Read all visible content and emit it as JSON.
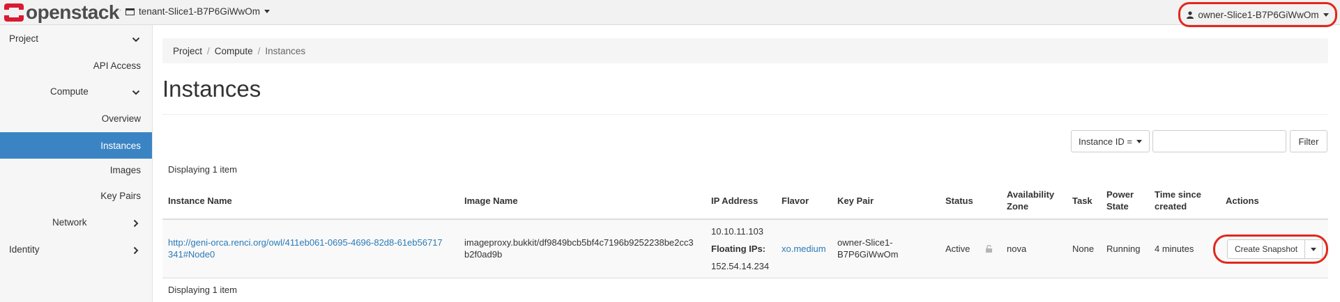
{
  "header": {
    "brand": "openstack",
    "project_selector": "tenant-Slice1-B7P6GiWwOm",
    "user_menu": "owner-Slice1-B7P6GiWwOm"
  },
  "sidebar": {
    "project": "Project",
    "api_access": "API Access",
    "compute": "Compute",
    "overview": "Overview",
    "instances": "Instances",
    "images": "Images",
    "key_pairs": "Key Pairs",
    "network": "Network",
    "identity": "Identity"
  },
  "breadcrumb": [
    "Project",
    "Compute",
    "Instances"
  ],
  "page": {
    "title": "Instances",
    "displaying_top": "Displaying 1 item",
    "displaying_bottom": "Displaying 1 item"
  },
  "filter": {
    "field": "Instance ID =",
    "value": "",
    "button": "Filter"
  },
  "table": {
    "columns": {
      "instance_name": "Instance Name",
      "image_name": "Image Name",
      "ip_address": "IP Address",
      "flavor": "Flavor",
      "key_pair": "Key Pair",
      "status": "Status",
      "availability_zone_1": "Availability",
      "availability_zone_2": "Zone",
      "task": "Task",
      "power_state_1": "Power",
      "power_state_2": "State",
      "time_since_created_1": "Time since",
      "time_since_created_2": "created",
      "actions": "Actions"
    },
    "rows": [
      {
        "instance_name_1": "http://geni-orca.renci.org/owl/411eb061-0695-4696-82d8-61eb56717",
        "instance_name_2": "341#Node0",
        "image_name_1": "imageproxy.bukkit/df9849bcb5bf4c7196b9252238be2cc3",
        "image_name_2": "b2f0ad9b",
        "ip_fixed": "10.10.11.103",
        "floating_label": "Floating IPs:",
        "ip_floating": "152.54.14.234",
        "flavor": "xo.medium",
        "key_pair_1": "owner-Slice1-",
        "key_pair_2": "B7P6GiWwOm",
        "status": "Active",
        "availability_zone": "nova",
        "task": "None",
        "power_state": "Running",
        "time_since_created": "4 minutes",
        "action": "Create Snapshot"
      }
    ]
  },
  "colors": {
    "accent": "#3b84c4",
    "link": "#2a7ab8",
    "highlight": "#e3261b",
    "logo_red": "#da1a32"
  }
}
